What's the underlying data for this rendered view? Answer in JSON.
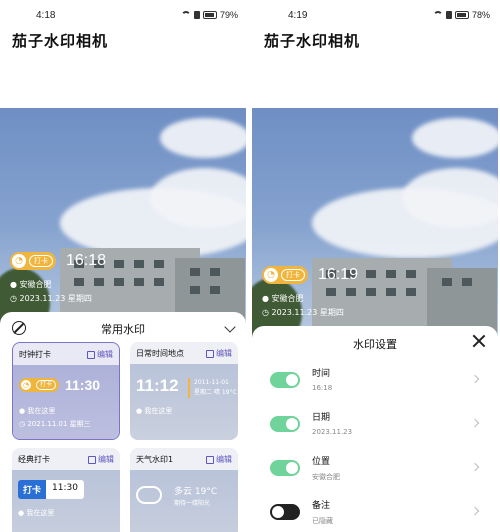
{
  "left": {
    "status": {
      "time": "4:18",
      "battery": "79%"
    },
    "app_title": "茄子水印相机",
    "watermark": {
      "badge": "打卡",
      "time": "16:18",
      "location": "安徽合肥",
      "date": "2023.11.23 星期四"
    },
    "sheet": {
      "title": "常用水印",
      "cards": [
        {
          "title": "时钟打卡",
          "edit": "编辑",
          "badge": "打卡",
          "time": "11:30",
          "location": "我在这里",
          "date": "2021.11.01 星期三"
        },
        {
          "title": "日常时间地点",
          "edit": "编辑",
          "time": "11:12",
          "date_line": "2011-11-01",
          "weather_line": "星期二 晴 19°C",
          "location": "我在这里"
        },
        {
          "title": "经典打卡",
          "edit": "编辑",
          "badge": "打卡",
          "time": "11:30",
          "location": "我在这里"
        },
        {
          "title": "天气水印1",
          "edit": "编辑",
          "weather": "多云 19°C",
          "note": "期待一缕阳光"
        }
      ]
    }
  },
  "right": {
    "status": {
      "time": "4:19",
      "battery": "78%"
    },
    "app_title": "茄子水印相机",
    "watermark": {
      "badge": "打卡",
      "time": "16:19",
      "location": "安徽合肥",
      "date": "2023.11.23 星期四"
    },
    "settings": {
      "title": "水印设置",
      "rows": [
        {
          "label": "时间",
          "value": "16:18",
          "on": true
        },
        {
          "label": "日期",
          "value": "2023.11.23",
          "on": true
        },
        {
          "label": "位置",
          "value": "安徽合肥",
          "on": true
        },
        {
          "label": "备注",
          "value": "已隐藏",
          "on": false
        }
      ]
    }
  },
  "colors": {
    "accent": "#f0b53c",
    "primary": "#5f56c0",
    "toggle_on": "#6fd39a",
    "toggle_off": "#222222"
  }
}
